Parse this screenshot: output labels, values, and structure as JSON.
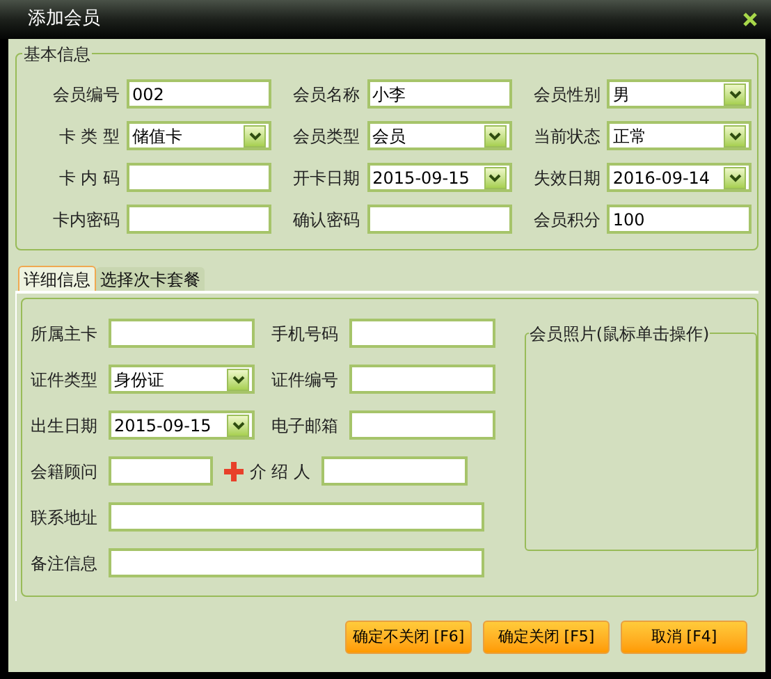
{
  "window": {
    "title": "添加会员"
  },
  "basic_info": {
    "title": "基本信息",
    "fields": [
      {
        "label": "会员编号",
        "kind": "text",
        "value": "002"
      },
      {
        "label": "会员名称",
        "kind": "text",
        "value": "小李"
      },
      {
        "label": "会员性别",
        "kind": "select",
        "value": "男"
      },
      {
        "label": "卡 类 型",
        "kind": "select",
        "value": "储值卡"
      },
      {
        "label": "会员类型",
        "kind": "select",
        "value": "会员"
      },
      {
        "label": "当前状态",
        "kind": "select",
        "value": "正常"
      },
      {
        "label": "卡 内 码",
        "kind": "text"
      },
      {
        "label": "开卡日期",
        "kind": "select",
        "value": "2015-09-15"
      },
      {
        "label": "失效日期",
        "kind": "select",
        "value": "2016-09-14"
      },
      {
        "label": "卡内密码",
        "kind": "text"
      },
      {
        "label": "确认密码",
        "kind": "text"
      },
      {
        "label": "会员积分",
        "kind": "text",
        "value": "100"
      }
    ]
  },
  "tabs": [
    {
      "label": "详细信息",
      "selected": true
    },
    {
      "label": "选择次卡套餐",
      "selected": false
    }
  ],
  "details": {
    "rows": [
      [
        {
          "label": "所属主卡",
          "kind": "text"
        },
        {
          "label": "手机号码",
          "kind": "text"
        }
      ],
      [
        {
          "label": "证件类型",
          "kind": "select",
          "value": "身份证"
        },
        {
          "label": "证件编号",
          "kind": "text"
        }
      ],
      [
        {
          "label": "出生日期",
          "kind": "select",
          "value": "2015-09-15"
        },
        {
          "label": "电子邮箱",
          "kind": "text"
        }
      ],
      [
        {
          "label": "会籍顾问",
          "kind": "add"
        },
        {
          "label": "介 绍 人",
          "kind": "text"
        }
      ],
      [
        {
          "label": "联系地址",
          "kind": "wide"
        }
      ],
      [
        {
          "label": "备注信息",
          "kind": "wide"
        }
      ]
    ],
    "photo_title": "会员照片(鼠标单击操作)"
  },
  "buttons": [
    "确定不关闭 [F6]",
    "确定关闭 [F5]",
    "取消 [F4]"
  ]
}
